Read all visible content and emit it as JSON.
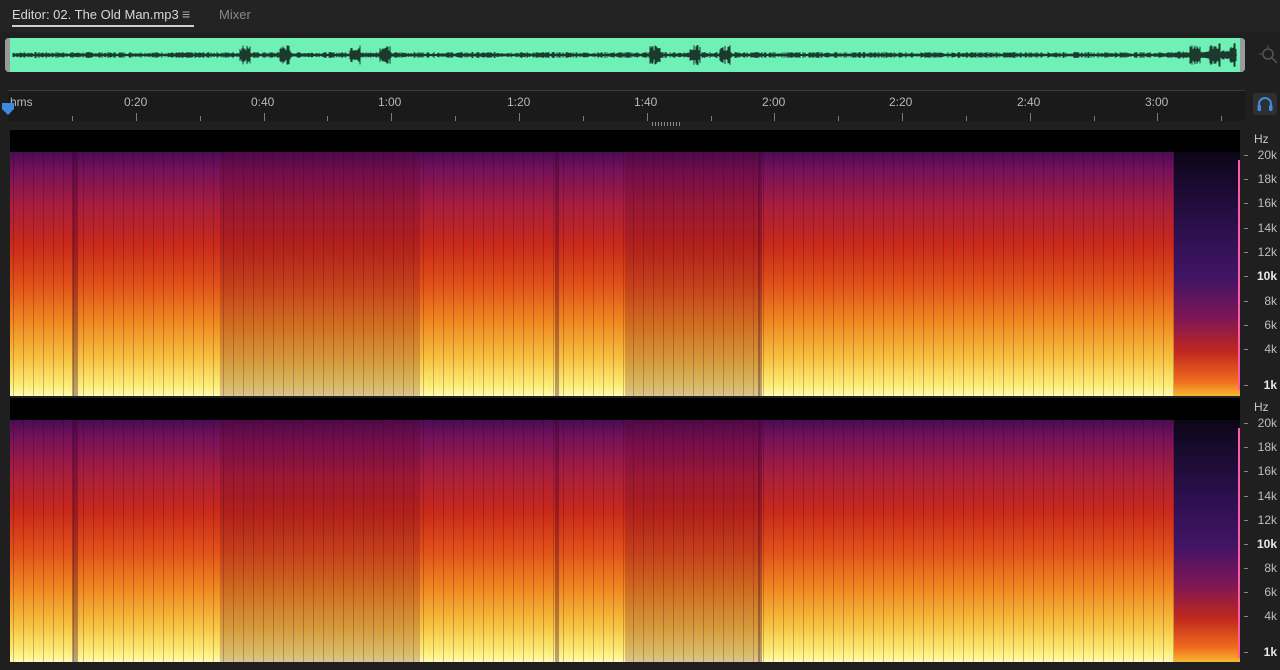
{
  "tabs": {
    "editor_label": "Editor: 02. The Old Man.mp3",
    "menu_glyph": "≡",
    "mixer_label": "Mixer"
  },
  "overview": {
    "waveform_color": "#6ff0b7",
    "zoom_icon": "zoom-icon"
  },
  "ruler": {
    "unit_label": "hms",
    "ticks": [
      "0:20",
      "0:40",
      "1:00",
      "1:20",
      "1:40",
      "2:00",
      "2:20",
      "2:40",
      "3:00"
    ]
  },
  "playhead": {
    "color": "#3d8be0",
    "icon": "playhead-icon"
  },
  "headphones": {
    "icon": "headphones-icon",
    "color": "#3d8be0"
  },
  "channels": [
    {
      "axis_unit": "Hz",
      "freq_labels": [
        "20k",
        "18k",
        "16k",
        "14k",
        "12k",
        "10k",
        "8k",
        "6k",
        "4k",
        "1k"
      ]
    },
    {
      "axis_unit": "Hz",
      "freq_labels": [
        "20k",
        "18k",
        "16k",
        "14k",
        "12k",
        "10k",
        "8k",
        "6k",
        "4k",
        "1k"
      ]
    }
  ],
  "colors": {
    "background": "#1f1f1f",
    "spectrum_low": "#fffbb5",
    "spectrum_mid": "#e2541a",
    "spectrum_high": "#4b0d55",
    "marker": "#ff5aa8"
  }
}
